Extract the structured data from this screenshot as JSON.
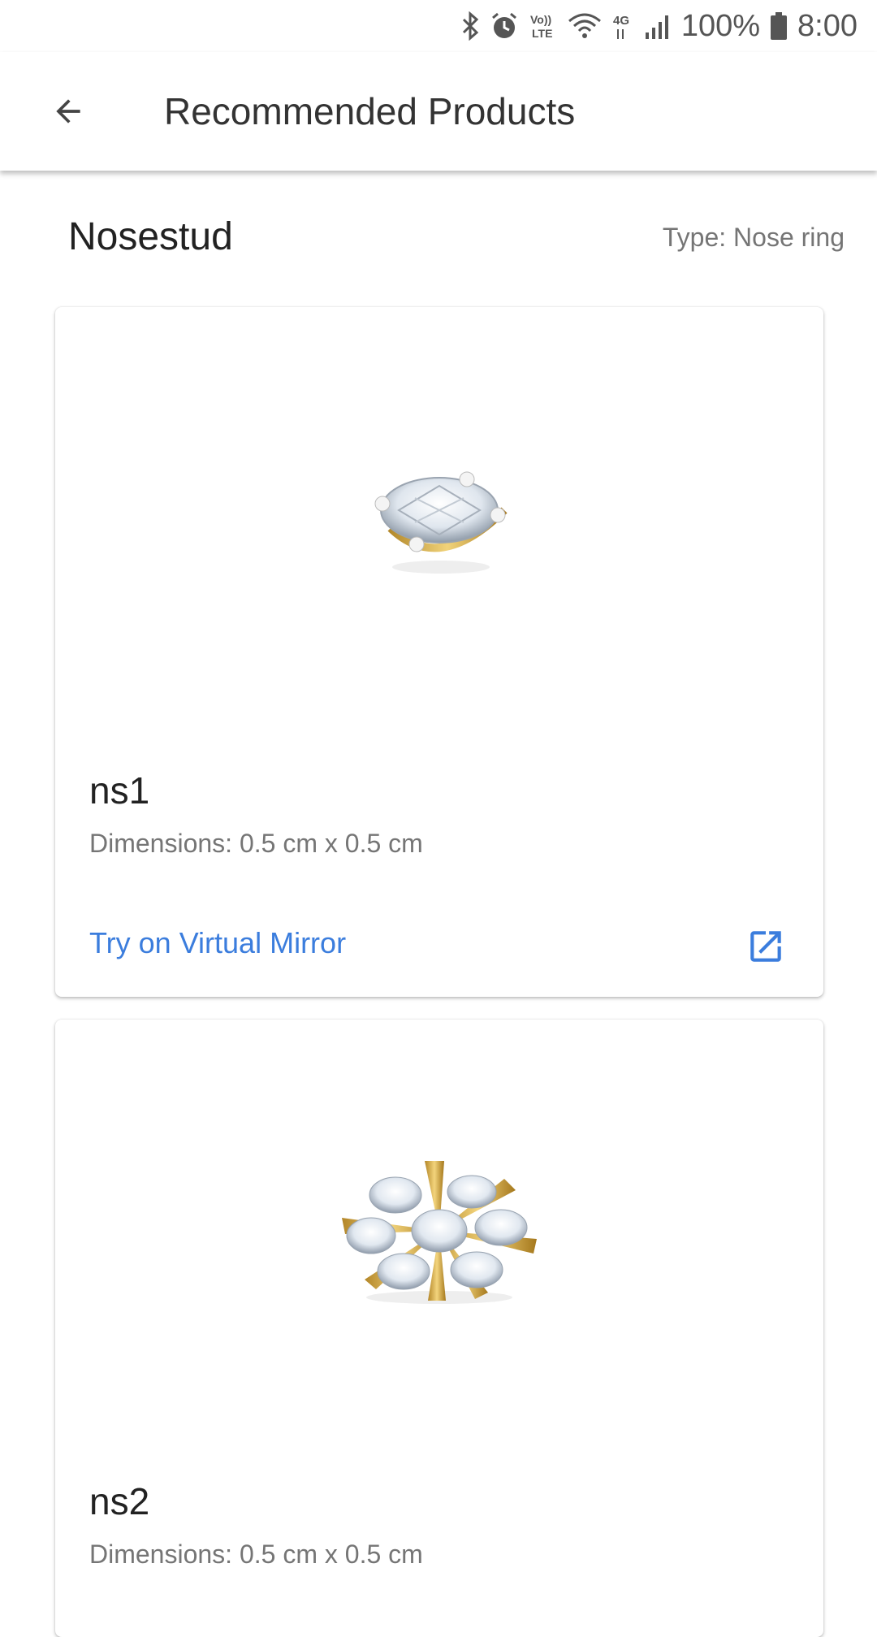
{
  "status_bar": {
    "battery_percent": "100%",
    "time": "8:00",
    "network_label": "4G",
    "volte_label": "Vo)) LTE",
    "icons": [
      "bluetooth-icon",
      "alarm-icon",
      "volte-icon",
      "wifi-icon",
      "4g-icon",
      "signal-icon",
      "battery-icon"
    ]
  },
  "app_bar": {
    "title": "Recommended Products",
    "back_icon": "arrow-back-icon"
  },
  "section": {
    "title": "Nosestud",
    "type_label": "Type: Nose ring"
  },
  "products": [
    {
      "name": "ns1",
      "dimensions": "Dimensions: 0.5 cm x 0.5 cm",
      "action_label": "Try on Virtual Mirror",
      "image": "diamond-solitaire-stud",
      "action_icon": "open-in-new-icon"
    },
    {
      "name": "ns2",
      "dimensions": "Dimensions: 0.5 cm x 0.5 cm",
      "image": "diamond-flower-stud"
    }
  ],
  "colors": {
    "accent": "#3b7ddd",
    "text_primary": "#222222",
    "text_secondary": "#757575",
    "gold": "#d6b04a"
  }
}
